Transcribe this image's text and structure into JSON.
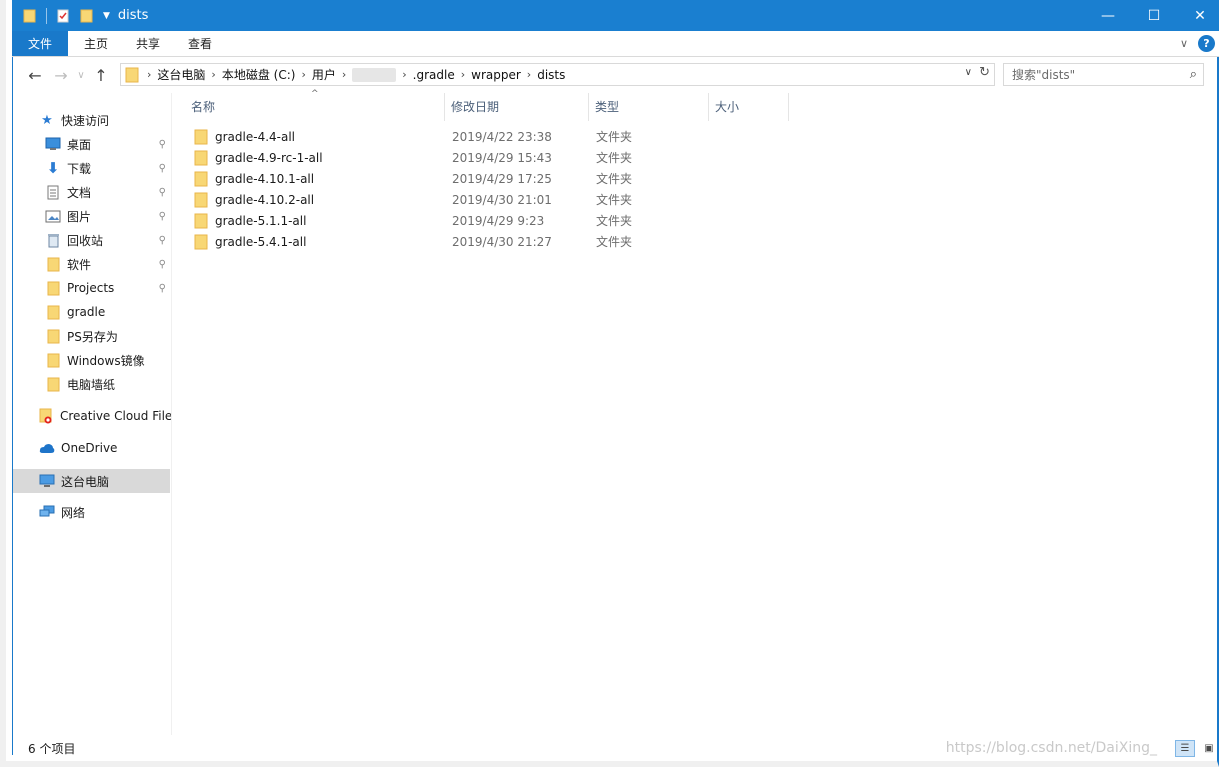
{
  "window": {
    "title": "dists",
    "controls": {
      "minimize": "—",
      "maximize": "☐",
      "close": "✕"
    }
  },
  "ribbon": {
    "tabs": [
      {
        "label": "文件"
      },
      {
        "label": "主页"
      },
      {
        "label": "共享"
      },
      {
        "label": "查看"
      }
    ],
    "collapse": "∨",
    "help": "?"
  },
  "address": {
    "crumbs": [
      "这台电脑",
      "本地磁盘 (C:)",
      "用户",
      ".gradle",
      "wrapper",
      "dists"
    ],
    "search_placeholder": "搜索\"dists\""
  },
  "navpane": {
    "quick_access": "快速访问",
    "items": [
      {
        "label": "桌面",
        "pinned": "📌",
        "icon": "desktop-icon"
      },
      {
        "label": "下载",
        "pinned": "📌",
        "icon": "download-icon"
      },
      {
        "label": "文档",
        "pinned": "📌",
        "icon": "document-icon"
      },
      {
        "label": "图片",
        "pinned": "📌",
        "icon": "picture-icon"
      },
      {
        "label": "回收站",
        "pinned": "📌",
        "icon": "recycle-bin-icon"
      },
      {
        "label": "软件",
        "pinned": "📌",
        "icon": "folder-icon"
      },
      {
        "label": "Projects",
        "pinned": "📌",
        "icon": "folder-icon"
      },
      {
        "label": "gradle",
        "icon": "folder-icon"
      },
      {
        "label": "PS另存为",
        "icon": "folder-icon"
      },
      {
        "label": "Windows镜像",
        "icon": "folder-icon"
      },
      {
        "label": "电脑墙纸",
        "icon": "folder-icon"
      }
    ],
    "creative_cloud": "Creative Cloud Files",
    "onedrive": "OneDrive",
    "this_pc": "这台电脑",
    "network": "网络"
  },
  "columns": {
    "name": "名称",
    "modified": "修改日期",
    "type": "类型",
    "size": "大小"
  },
  "files": [
    {
      "name": "gradle-4.4-all",
      "modified": "2019/4/22 23:38",
      "type": "文件夹"
    },
    {
      "name": "gradle-4.9-rc-1-all",
      "modified": "2019/4/29 15:43",
      "type": "文件夹"
    },
    {
      "name": "gradle-4.10.1-all",
      "modified": "2019/4/29 17:25",
      "type": "文件夹"
    },
    {
      "name": "gradle-4.10.2-all",
      "modified": "2019/4/30 21:01",
      "type": "文件夹"
    },
    {
      "name": "gradle-5.1.1-all",
      "modified": "2019/4/29 9:23",
      "type": "文件夹"
    },
    {
      "name": "gradle-5.4.1-all",
      "modified": "2019/4/30 21:27",
      "type": "文件夹"
    }
  ],
  "status": {
    "count": "6 个项目",
    "watermark": "https://blog.csdn.net/DaiXing_"
  },
  "colors": {
    "accent": "#1979ca",
    "folder": "#f8d775",
    "folder_dark": "#e8b64a"
  }
}
